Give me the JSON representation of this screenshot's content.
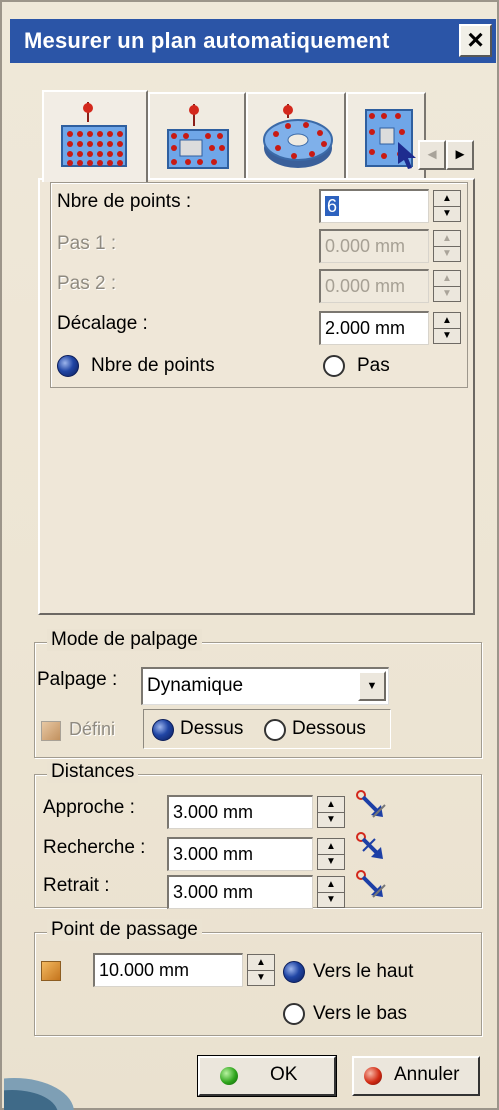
{
  "dialog": {
    "title": "Mesurer un plan automatiquement",
    "close_label": "×"
  },
  "tabs": {
    "items": [
      {
        "icon": "grid-points-plane-icon",
        "active": true
      },
      {
        "icon": "hole-points-plane-icon",
        "active": false
      },
      {
        "icon": "circular-points-plane-icon",
        "active": false
      },
      {
        "icon": "pocket-points-plane-icon",
        "active": false
      }
    ],
    "scroll_left": "◄",
    "scroll_right": "►"
  },
  "points": {
    "nb_points_label": "Nbre de points :",
    "nb_points_value": "6",
    "pas1_label": "Pas 1 :",
    "pas1_value": "0.000 mm",
    "pas2_label": "Pas 2 :",
    "pas2_value": "0.000 mm",
    "decalage_label": "Décalage :",
    "decalage_value": "2.000 mm",
    "radio_nb_points": "Nbre de points",
    "radio_pas": "Pas",
    "selected_mode": "Nbre de points"
  },
  "palpage": {
    "group_title": "Mode de palpage",
    "palpage_label": "Palpage :",
    "palpage_value": "Dynamique",
    "defini_label": "Défini",
    "radio_dessus": "Dessus",
    "radio_dessous": "Dessous",
    "selected_side": "Dessus"
  },
  "distances": {
    "group_title": "Distances",
    "approche_label": "Approche :",
    "approche_value": "3.000 mm",
    "recherche_label": "Recherche :",
    "recherche_value": "3.000 mm",
    "retrait_label": "Retrait :",
    "retrait_value": "3.000 mm"
  },
  "passage": {
    "group_title": "Point de passage",
    "value": "10.000 mm",
    "radio_haut": "Vers le haut",
    "radio_bas": "Vers le bas",
    "selected_direction": "Vers le haut"
  },
  "footer": {
    "ok_label": "OK",
    "cancel_label": "Annuler"
  },
  "colors": {
    "titlebar": "#2b55a7",
    "dialog_bg": "#ede5d4",
    "selection": "#2d62bf"
  }
}
